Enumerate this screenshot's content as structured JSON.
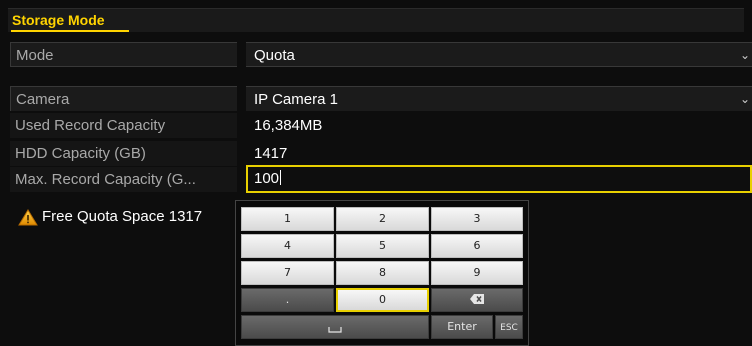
{
  "title": "Storage Mode",
  "mode": {
    "label": "Mode",
    "value": "Quota"
  },
  "camera": {
    "label": "Camera",
    "value": "IP Camera 1"
  },
  "used": {
    "label": "Used Record Capacity",
    "value": "16,384MB"
  },
  "hdd": {
    "label": "HDD Capacity (GB)",
    "value": "1417"
  },
  "max": {
    "label": "Max. Record Capacity (G...",
    "value": "100"
  },
  "warning": {
    "text": "Free Quota Space 1317",
    "icon": "warning-icon",
    "color": "#f2a500"
  },
  "keypad": {
    "keys": [
      "1",
      "2",
      "3",
      "4",
      "5",
      "6",
      "7",
      "8",
      "9",
      ".",
      "0"
    ],
    "backspace_icon": "backspace-icon",
    "space_icon": "space-icon",
    "enter": "Enter",
    "esc": "ESC",
    "active_key": "0"
  },
  "colors": {
    "accent": "#ffd400",
    "background": "#0d0d0d",
    "label": "#a9a9a9"
  }
}
